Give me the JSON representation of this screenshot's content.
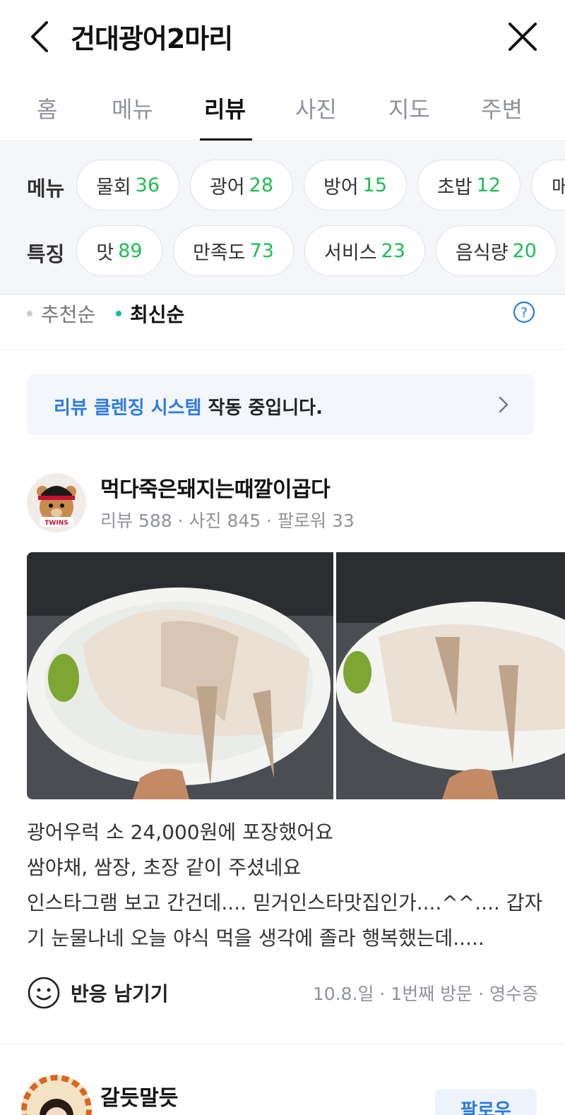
{
  "header": {
    "title": "건대광어2마리"
  },
  "tabs": [
    {
      "label": "홈"
    },
    {
      "label": "메뉴"
    },
    {
      "label": "리뷰"
    },
    {
      "label": "사진"
    },
    {
      "label": "지도"
    },
    {
      "label": "주변"
    }
  ],
  "active_tab": "리뷰",
  "filters": {
    "menu_label": "메뉴",
    "menu_chips": [
      {
        "name": "물회",
        "count": "36"
      },
      {
        "name": "광어",
        "count": "28"
      },
      {
        "name": "방어",
        "count": "15"
      },
      {
        "name": "초밥",
        "count": "12"
      },
      {
        "name": "매",
        "count": ""
      }
    ],
    "feature_label": "특징",
    "feature_chips": [
      {
        "name": "맛",
        "count": "89"
      },
      {
        "name": "만족도",
        "count": "73"
      },
      {
        "name": "서비스",
        "count": "23"
      },
      {
        "name": "음식량",
        "count": "20"
      }
    ]
  },
  "sort": {
    "options": [
      "추천순",
      "최신순"
    ],
    "active": "최신순"
  },
  "notice": {
    "highlight": "리뷰 클렌징 시스템",
    "rest": " 작동 중입니다."
  },
  "review": {
    "user_name": "먹다죽은돼지는때깔이곱다",
    "stats": "리뷰 588 · 사진 845 · 팔로워 33",
    "avatar_text": "TWINS",
    "text_lines": [
      "광어우럭 소 24,000원에 포장했어요",
      "쌈야채, 쌈장, 초장 같이 주셨네요",
      "인스타그램 보고 간건데.... 믿거인스타맛집인가....^^.... 갑자",
      "기 눈물나네 오늘 야식 먹을 생각에 졸라 행복했는데....."
    ],
    "reaction_label": "반응 남기기",
    "meta": "10.8.일 · 1번째 방문 · 영수증"
  },
  "next_review": {
    "user_name": "갈듯말듯",
    "follow_label": "팔로우"
  },
  "colors": {
    "count_green": "#1ebd52",
    "link_blue": "#2e7be0",
    "active_dot": "#15b8a6"
  }
}
